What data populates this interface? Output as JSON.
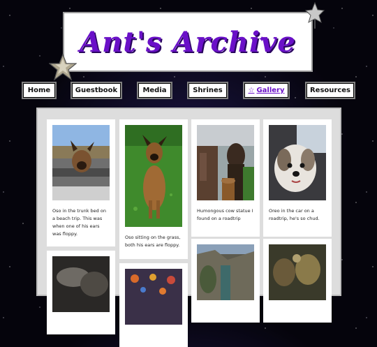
{
  "header": {
    "title": "Ant's Archive"
  },
  "nav": {
    "items": [
      {
        "label": "Home",
        "active": false
      },
      {
        "label": "Guestbook",
        "active": false
      },
      {
        "label": "Media",
        "active": false
      },
      {
        "label": "Shrines",
        "active": false
      },
      {
        "label": "Gallery",
        "active": true
      },
      {
        "label": "Resources",
        "active": false
      }
    ],
    "active_marker": "☆"
  },
  "gallery": {
    "items": [
      {
        "caption": "Oso in the trunk bed on a beach trip. This was when one of his ears was floppy."
      },
      {
        "caption": "Oso sitting on the grass, both his ears are floppy."
      },
      {
        "caption": "Humongous cow statue I found on a roadtrip"
      },
      {
        "caption": "Oreo in the car on a roadtrip, he's so chud."
      },
      {
        "caption": ""
      },
      {
        "caption": ""
      },
      {
        "caption": ""
      },
      {
        "caption": ""
      }
    ]
  },
  "colors": {
    "accent": "#6a10c8",
    "background": "#05040c",
    "panel": "#dddddd"
  }
}
